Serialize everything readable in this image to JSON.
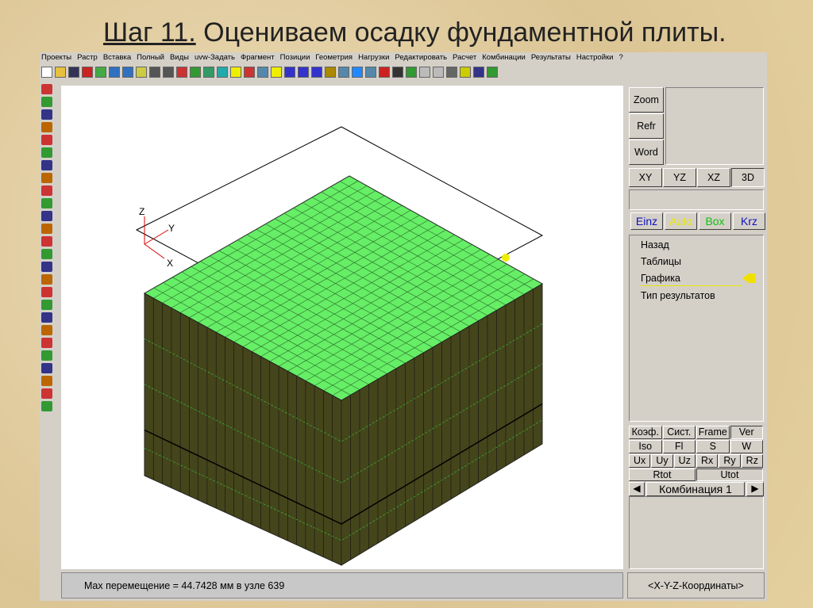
{
  "title": {
    "step": "Шаг 11.",
    "text": " Оцениваем осадку фундаментной плиты."
  },
  "menu": [
    "Проекты",
    "Растр",
    "Вставка",
    "Полный",
    "Виды",
    "uvw-Задать",
    "Фрагмент",
    "Позиции",
    "Геометрия",
    "Нагрузки",
    "Редактировать",
    "Расчет",
    "Комбинации",
    "Результаты",
    "Настройки",
    "?"
  ],
  "axes": {
    "z": "Z",
    "y": "Y",
    "x": "X"
  },
  "status": "Max перемещение  = 44.7428 мм в узле 639",
  "coords": "<X-Y-Z-Координаты>",
  "right": {
    "side_buttons": [
      "Zoom",
      "Refr",
      "Word"
    ],
    "views": [
      "XY",
      "YZ",
      "XZ",
      "3D"
    ],
    "modes": [
      {
        "label": "Einz",
        "color": "#1010c0"
      },
      {
        "label": "Auto",
        "color": "#e8e800"
      },
      {
        "label": "Box",
        "color": "#10c010"
      },
      {
        "label": "Krz",
        "color": "#1010c0"
      }
    ],
    "menu": [
      "Назад",
      "Таблицы",
      "Графика",
      "Тип результатов"
    ],
    "row1": [
      "Коэф.",
      "Сист.",
      "Frame",
      "Ver"
    ],
    "row2": [
      "Iso",
      "Fl",
      "S",
      "W"
    ],
    "row3": [
      "Ux",
      "Uy",
      "Uz",
      "Rx",
      "Ry",
      "Rz"
    ],
    "row4": [
      "Rtot",
      "Utot"
    ],
    "combo": "Комбинация 1"
  },
  "colors": {
    "top": "#66ee66",
    "side": "#45451c"
  }
}
